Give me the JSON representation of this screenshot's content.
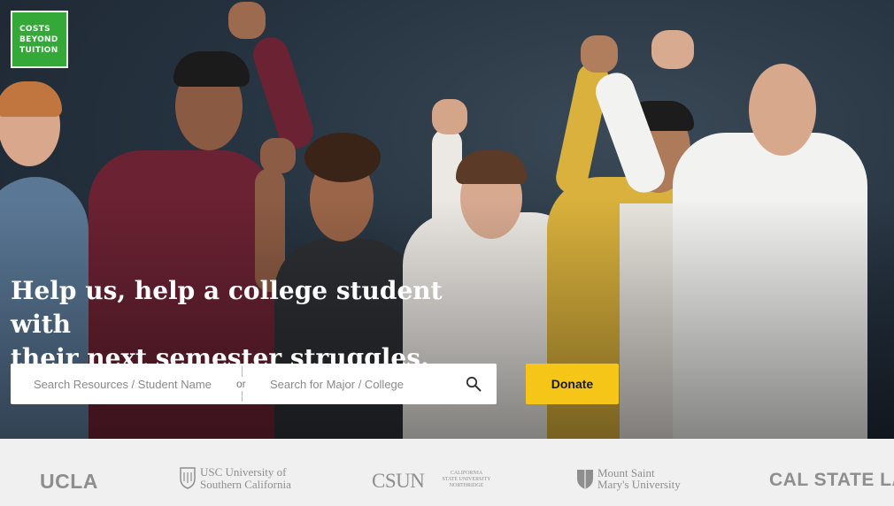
{
  "brand": {
    "logo_lines": [
      "COSTS",
      "BEYOND",
      "TUITION"
    ],
    "logo_color": "#35a83a"
  },
  "hero": {
    "headline_line1": "Help us, help a college student with",
    "headline_line2": "their next semester struggles.",
    "image_alt": "Group of cheering students raising fists"
  },
  "search": {
    "student_placeholder": "Search Resources / Student Name",
    "or_label": "or",
    "major_placeholder": "Search for Major / College",
    "search_icon": "search-icon"
  },
  "donate": {
    "label": "Donate",
    "color": "#f5c518"
  },
  "universities": {
    "ucla": "UCLA",
    "usc_line1": "USC University of",
    "usc_line2": "Southern California",
    "csun": "CSUN",
    "csun_sub1": "CALIFORNIA",
    "csun_sub2": "STATE UNIVERSITY",
    "csun_sub3": "NORTHRIDGE",
    "msmu_line1": "Mount Saint",
    "msmu_line2": "Mary's University",
    "csla": "CAL STATE LA"
  }
}
